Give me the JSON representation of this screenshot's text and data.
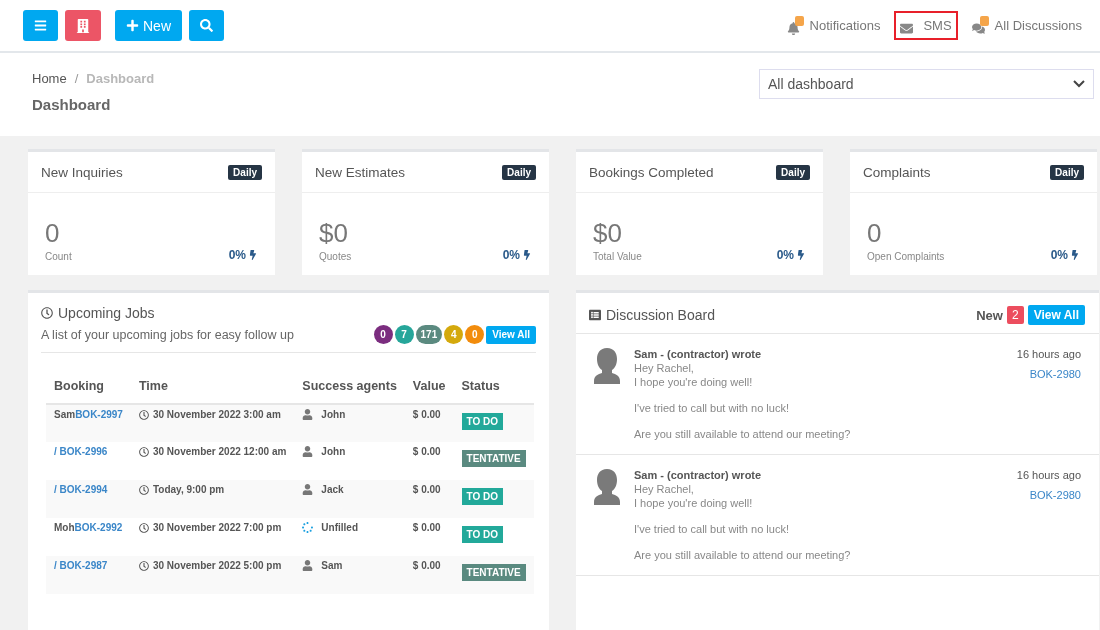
{
  "toolbar": {
    "buttons": [
      {
        "kind": "menu"
      },
      {
        "kind": "building"
      },
      {
        "kind": "new",
        "label": "New"
      },
      {
        "kind": "search"
      }
    ],
    "links": [
      {
        "kind": "bell",
        "label": "Notifications",
        "highlighted": false
      },
      {
        "kind": "mail",
        "label": "SMS",
        "highlighted": true
      },
      {
        "kind": "chat",
        "label": "All Discussions",
        "highlighted": false
      }
    ]
  },
  "breadcrumb": {
    "items": [
      "Home",
      "Dashboard"
    ],
    "separator": "/"
  },
  "page_title": "Dashboard",
  "dashboard_select": {
    "value": "All dashboard"
  },
  "stats": [
    {
      "title": "New Inquiries",
      "badge": "Daily",
      "value": "0",
      "caption": "Count",
      "change": "0%"
    },
    {
      "title": "New Estimates",
      "badge": "Daily",
      "value": "$0",
      "caption": "Quotes",
      "change": "0%"
    },
    {
      "title": "Bookings Completed",
      "badge": "Daily",
      "value": "$0",
      "caption": "Total Value",
      "change": "0%"
    },
    {
      "title": "Complaints",
      "badge": "Daily",
      "value": "0",
      "caption": "Open Complaints",
      "change": "0%"
    }
  ],
  "upcoming_jobs": {
    "title": "Upcoming Jobs",
    "subtitle": "A list of your upcoming jobs for easy follow up",
    "counts": [
      {
        "label": "0",
        "color": "#7b2d7f"
      },
      {
        "label": "7",
        "color": "#26a69a"
      },
      {
        "label": "171",
        "color": "#5b8a80"
      },
      {
        "label": "4",
        "color": "#d4a90c"
      },
      {
        "label": "0",
        "color": "#f28c0c"
      }
    ],
    "view_all": "View All",
    "columns": [
      "Booking",
      "Time",
      "Success agents",
      "Value",
      "Status"
    ],
    "rows": [
      {
        "prefix": "Sam",
        "code": "BOK-2997",
        "time": "30 November 2022 3:00 am",
        "agent": {
          "kind": "person",
          "name": "John"
        },
        "value": "$ 0.00",
        "status": {
          "kind": "todo",
          "label": "TO DO"
        }
      },
      {
        "prefix": "/ ",
        "code": "BOK-2996",
        "time": "30 November 2022 12:00 am",
        "agent": {
          "kind": "person",
          "name": "John"
        },
        "value": "$ 0.00",
        "status": {
          "kind": "tentative",
          "label": "TENTATIVE"
        }
      },
      {
        "prefix": "/ ",
        "code": "BOK-2994",
        "time": "Today, 9:00 pm",
        "agent": {
          "kind": "person",
          "name": "Jack"
        },
        "value": "$ 0.00",
        "status": {
          "kind": "todo",
          "label": "TO DO"
        }
      },
      {
        "prefix": "Moh",
        "code": "BOK-2992",
        "time": "30 November 2022 7:00 pm",
        "agent": {
          "kind": "unfilled",
          "name": "Unfilled"
        },
        "value": "$ 0.00",
        "status": {
          "kind": "todo",
          "label": "TO DO"
        }
      },
      {
        "prefix": "/ ",
        "code": "BOK-2987",
        "time": "30 November 2022 5:00 pm",
        "agent": {
          "kind": "person",
          "name": "Sam"
        },
        "value": "$ 0.00",
        "status": {
          "kind": "tentative",
          "label": "TENTATIVE"
        }
      }
    ]
  },
  "discussion_board": {
    "title": "Discussion Board",
    "new_label": "New",
    "new_count": "2",
    "view_all": "View All",
    "posts": [
      {
        "author": "Sam - (contractor) wrote",
        "time": "16 hours ago",
        "booking": "BOK-2980",
        "lines": [
          "Hey Rachel,",
          "I hope you're doing well!",
          "I've tried to call but with no luck!",
          "Are you still available to attend our meeting?"
        ]
      },
      {
        "author": "Sam - (contractor) wrote",
        "time": "16 hours ago",
        "booking": "BOK-2980",
        "lines": [
          "Hey Rachel,",
          "I hope you're doing well!",
          "I've tried to call but with no luck!",
          "Are you still available to attend our meeting?"
        ]
      }
    ]
  }
}
